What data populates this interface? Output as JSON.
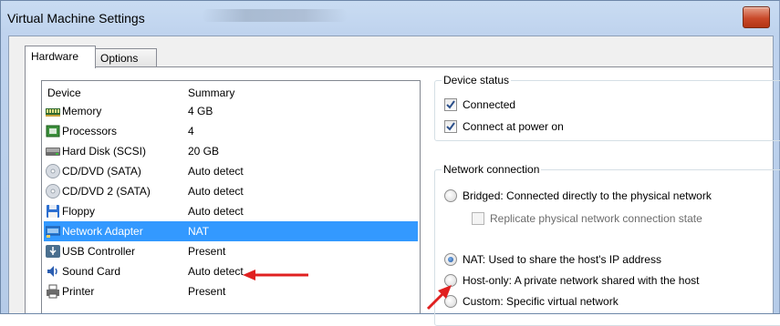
{
  "window": {
    "title": "Virtual Machine Settings"
  },
  "tabs": [
    {
      "label": "Hardware",
      "active": true
    },
    {
      "label": "Options",
      "active": false
    }
  ],
  "device_list": {
    "columns": [
      "Device",
      "Summary"
    ],
    "rows": [
      {
        "device": "Memory",
        "summary": "4 GB",
        "icon": "memory-icon"
      },
      {
        "device": "Processors",
        "summary": "4",
        "icon": "processor-icon"
      },
      {
        "device": "Hard Disk (SCSI)",
        "summary": "20 GB",
        "icon": "hard-disk-icon"
      },
      {
        "device": "CD/DVD (SATA)",
        "summary": "Auto detect",
        "icon": "cd-dvd-icon"
      },
      {
        "device": "CD/DVD 2 (SATA)",
        "summary": "Auto detect",
        "icon": "cd-dvd-icon"
      },
      {
        "device": "Floppy",
        "summary": "Auto detect",
        "icon": "floppy-icon"
      },
      {
        "device": "Network Adapter",
        "summary": "NAT",
        "icon": "network-adapter-icon",
        "selected": true
      },
      {
        "device": "USB Controller",
        "summary": "Present",
        "icon": "usb-icon"
      },
      {
        "device": "Sound Card",
        "summary": "Auto detect",
        "icon": "sound-card-icon"
      },
      {
        "device": "Printer",
        "summary": "Present",
        "icon": "printer-icon"
      }
    ]
  },
  "device_status": {
    "legend": "Device status",
    "connected": {
      "label": "Connected",
      "checked": true
    },
    "connect_at_power_on": {
      "label": "Connect at power on",
      "checked": true
    }
  },
  "network_connection": {
    "legend": "Network connection",
    "options": [
      {
        "label": "Bridged: Connected directly to the physical network",
        "selected": false
      },
      {
        "label": "Replicate physical network connection state",
        "type": "checkbox",
        "checked": false,
        "disabled": true
      },
      {
        "label": "NAT: Used to share the host's IP address",
        "selected": true
      },
      {
        "label": "Host-only: A private network shared with the host",
        "selected": false
      },
      {
        "label": "Custom: Specific virtual network",
        "selected": false
      }
    ]
  },
  "colors": {
    "selection": "#3399ff",
    "annotation_arrow": "#e02020"
  }
}
